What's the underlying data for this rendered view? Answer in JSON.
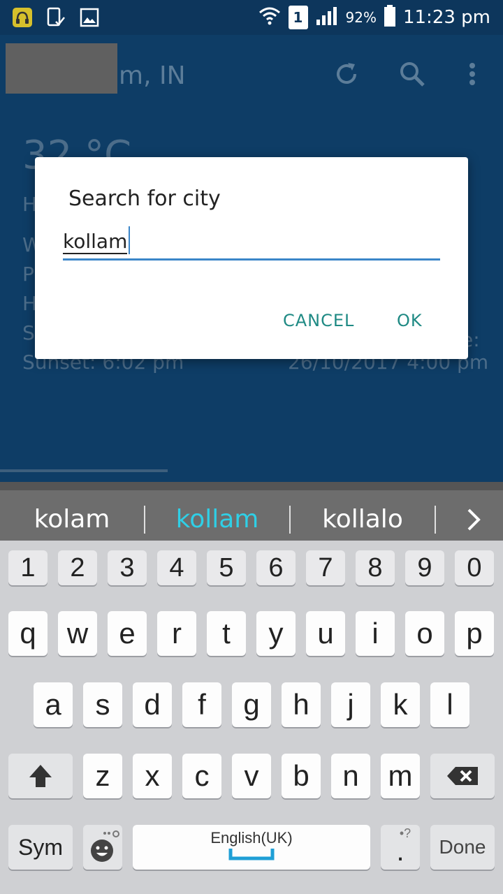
{
  "status_bar": {
    "battery_percent": "92%",
    "time": "11:23 pm",
    "sim_slot": "1",
    "icons": [
      "headset-icon",
      "device-check-icon",
      "image-icon",
      "wifi-icon",
      "signal-icon",
      "battery-icon"
    ]
  },
  "app": {
    "location_title": "m, IN",
    "temperature_fragment": "32 °C",
    "sunset": "Sunset: 6:02 pm",
    "updated": "26/10/2017 4:00 pm",
    "left_fragments": [
      "H",
      "W",
      "P",
      "H",
      "S"
    ],
    "right_fragment": "e:",
    "toolbar_icons": [
      "refresh-icon",
      "search-icon",
      "more-vert-icon"
    ]
  },
  "dialog": {
    "title": "Search for city",
    "input_value": "kollam",
    "cancel_label": "CANCEL",
    "ok_label": "OK"
  },
  "keyboard": {
    "suggestions": [
      "kolam",
      "kollam",
      "kollalo"
    ],
    "active_suggestion": "kollam",
    "number_row": [
      "1",
      "2",
      "3",
      "4",
      "5",
      "6",
      "7",
      "8",
      "9",
      "0"
    ],
    "row1": [
      "q",
      "w",
      "e",
      "r",
      "t",
      "y",
      "u",
      "i",
      "o",
      "p"
    ],
    "row2": [
      "a",
      "s",
      "d",
      "f",
      "g",
      "h",
      "j",
      "k",
      "l"
    ],
    "row3": [
      "z",
      "x",
      "c",
      "v",
      "b",
      "n",
      "m"
    ],
    "sym_label": "Sym",
    "space_label": "English(UK)",
    "period_label": ".",
    "done_label": "Done",
    "period_hint": "•?"
  },
  "colors": {
    "app_background": "#0e3d66",
    "dialog_accent": "#3b86c8",
    "button_text": "#1f8a84",
    "active_suggestion": "#2fcfe6"
  }
}
